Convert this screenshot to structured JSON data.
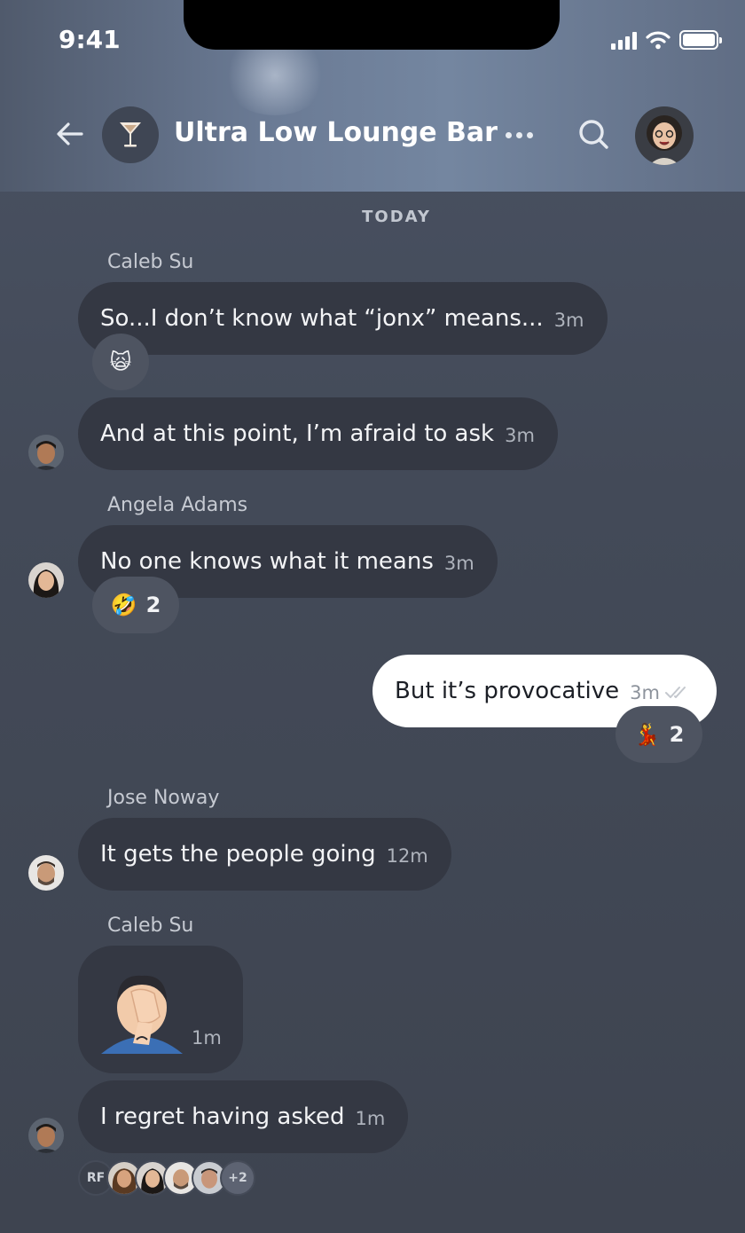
{
  "status_bar": {
    "time": "9:41"
  },
  "header": {
    "title": "Ultra Low Lounge Bar",
    "group_icon": "cocktail-glass-icon"
  },
  "day_divider": "TODAY",
  "messages": [
    {
      "sender": "Caleb Su",
      "text": "So...I don’t know what “jonx” means...",
      "time": "3m",
      "reaction": {
        "emoji": "🙀",
        "count": ""
      }
    },
    {
      "text": "And at this point, I’m afraid to ask",
      "time": "3m"
    },
    {
      "sender": "Angela Adams",
      "text": "No one knows what it means",
      "time": "3m",
      "reaction": {
        "emoji": "🤣",
        "count": "2"
      }
    },
    {
      "text": "But it’s provocative",
      "time": "3m",
      "mine": true,
      "reaction": {
        "emoji": "💃",
        "count": "2"
      }
    },
    {
      "sender": "Jose Noway",
      "text": "It gets the people going",
      "time": "12m"
    },
    {
      "sender": "Caleb Su",
      "sticker": "🤦‍♂️",
      "time": "1m"
    },
    {
      "text": "I regret having asked",
      "time": "1m"
    }
  ],
  "read_receipts": {
    "initials": "RF",
    "more": "+2"
  }
}
